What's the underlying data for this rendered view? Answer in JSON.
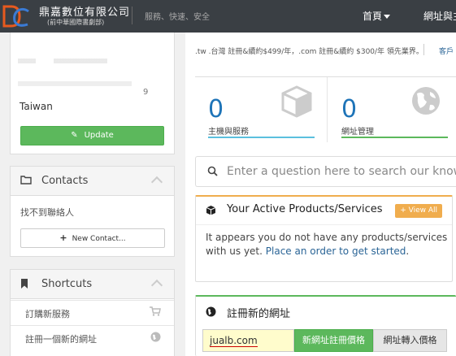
{
  "header": {
    "company_name": "鼎嘉數位有限公司",
    "company_sub": "(前中華國際書劇部)",
    "tagline": "服務、快速、安全",
    "nav_home": "首頁",
    "nav_domain": "網址與主"
  },
  "sidebar": {
    "address": {
      "fragment": "9",
      "country": "Taiwan",
      "update_label": "Update"
    },
    "contacts": {
      "title": "Contacts",
      "empty_text": "找不到聯絡人",
      "new_contact_label": "New Contact..."
    },
    "shortcuts": {
      "title": "Shortcuts",
      "items": [
        {
          "label": "訂購新服務",
          "icon": "cart-icon"
        },
        {
          "label": "註冊一個新的網址",
          "icon": "globe-icon"
        }
      ]
    }
  },
  "main": {
    "announcement": ".tw .台灣 註冊&續約$499/年，.com 註冊&續約 $300/年 領先業界。",
    "announcement_link": "客戶",
    "stats": [
      {
        "value": "0",
        "label": "主機與服務",
        "icon": "cube-icon"
      },
      {
        "value": "0",
        "label": "網址管理",
        "icon": "globe-icon"
      }
    ],
    "kb_search": {
      "placeholder": "Enter a question here to search our knowledge base"
    },
    "products_panel": {
      "title": "Your Active Products/Services",
      "view_all": "View All",
      "empty_text": "It appears you do not have any products/services with us yet.",
      "order_link": "Place an order to get started"
    },
    "domain_panel": {
      "title": "註冊新的網址",
      "input_value": "jualb.com",
      "register_label": "新網址註冊價格",
      "transfer_label": "網址轉入價格"
    }
  },
  "colors": {
    "header_bg": "#3a3f44",
    "primary_blue": "#1e74b8",
    "success_green": "#5cb85c",
    "warning_orange": "#f0ad4e",
    "info_blue": "#5bc0de"
  }
}
